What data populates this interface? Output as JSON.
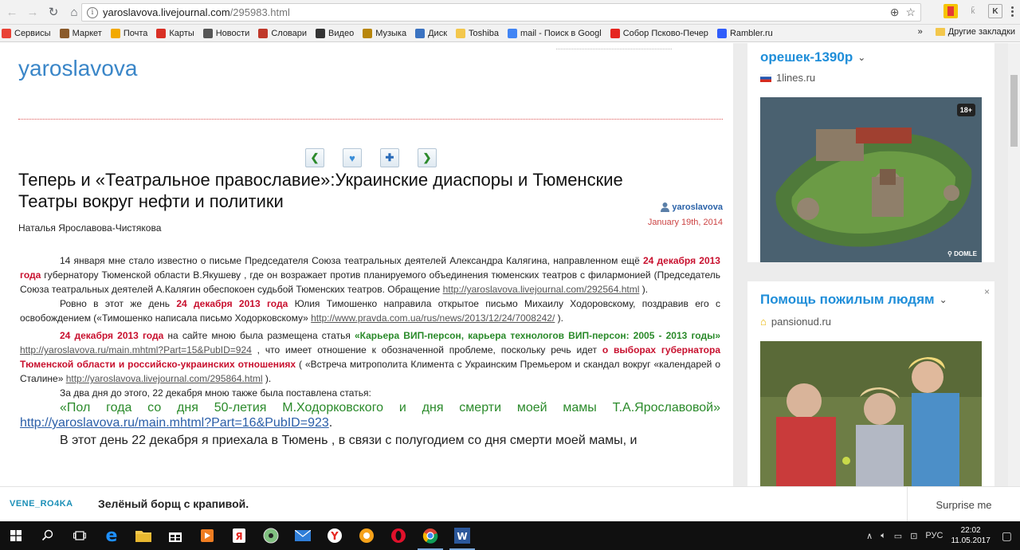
{
  "browser": {
    "url_domain": "yaroslavova.livejournal.com",
    "url_path": "/295983.html",
    "bookmarks": [
      {
        "label": "Сервисы",
        "icon": "apps-icon",
        "color": "#e94235"
      },
      {
        "label": "Маркет",
        "icon": "market-icon",
        "color": "#8a5a2a"
      },
      {
        "label": "Почта",
        "icon": "mail-icon",
        "color": "#f2a900"
      },
      {
        "label": "Карты",
        "icon": "map-pin-icon",
        "color": "#d93025"
      },
      {
        "label": "Новости",
        "icon": "news-icon",
        "color": "#555555"
      },
      {
        "label": "Словари",
        "icon": "dictionary-icon",
        "color": "#c0392b"
      },
      {
        "label": "Видео",
        "icon": "video-icon",
        "color": "#333333"
      },
      {
        "label": "Музыка",
        "icon": "music-icon",
        "color": "#b8860b"
      },
      {
        "label": "Диск",
        "icon": "disk-icon",
        "color": "#3b73c1"
      },
      {
        "label": "Toshiba",
        "icon": "folder-icon",
        "color": "#f3c74c"
      },
      {
        "label": "mail - Поиск в Googl",
        "icon": "google-icon",
        "color": "#4285f4"
      },
      {
        "label": "Собор Псково-Печер",
        "icon": "yandex-icon",
        "color": "#e52620"
      },
      {
        "label": "Rambler.ru",
        "icon": "rambler-icon",
        "color": "#315efb"
      }
    ],
    "more": "»",
    "other_bookmarks": "Другие закладки"
  },
  "site": {
    "title": "yaroslavova"
  },
  "post": {
    "title": "Теперь и «Театральное православие»:Украинские диаспоры и Тюменские Театры вокруг нефти и политики",
    "author": "yaroslavova",
    "date": "January 19th, 2014",
    "byline": "Наталья  Ярославова-Чистякова",
    "p1": {
      "a": "14     января мне стало известно   о письме   Председателя      Союза театральных  деятелей   Александра   Калягина,  направленном   ещё ",
      "red1": "24 декабря   2013 года",
      "b": " губернатору  Тюменской  области В.Якушеву , где он возражает  против     планируемого объединения    тюменских театров с    филармонией   (Председатель Союза театральных деятелей А.Калягин обеспокоен судьбой Тюменских театров. Обращение ",
      "link": "http://yaroslavova.livejournal.com/292564.html",
      "c": " )."
    },
    "p2": {
      "a": "Ровно в   этот  же  день  ",
      "red": "24 декабря 2013 года",
      "b": "   Юлия Тимошенко  направила  открытое  письмо   Михаилу Ходоровскому,  поздравив    его с освобождением («Тимошенко написала письмо Ходорковскому» ",
      "link": "http://www.pravda.com.ua/rus/news/2013/12/24/7008242/",
      "c": " )."
    },
    "p3": {
      "red": "24 декабря    2013 года",
      "a": "    на    сайте  мною  была размещена  статья ",
      "green": "«Карьера ВИП-персон, карьера технологов ВИП-персон: 2005 - 2013 годы»",
      "b": " ",
      "link": "http://yaroslavova.ru/main.mhtml?Part=15&PubID=924",
      "c": " , что     имеет  отношение к  обозначенной  проблеме,  поскольку речь идет ",
      "red2": "о выборах губернатора  Тюменской  области и   российско-украинских отношениях",
      "d": "  ( «Встреча митрополита Климента с Украинским Премьером и скандал вокруг «календарей о Сталине» ",
      "link2": "http://yaroslavova.livejournal.com/295864.html",
      "e": " )."
    },
    "p4": "За   два   дня  до этого, 22  декабря   мною  также  была  поставлена  статья:",
    "p5": {
      "green": "«Пол  года  со  дня  50-летия  М.Ходорковского  и  дня  смерти  моей  мамы  Т.А.Ярославовой»",
      "link": "http://yaroslavova.ru/main.mhtml?Part=16&PubID=923",
      "end": "."
    },
    "p6": "В  этот  день 22 декабря   я приехала в Тюмень  ,  в  связи с полугодием со  дня  смерти моей мамы,    и"
  },
  "ads": [
    {
      "title": "орешек-1390р",
      "source": "1lines.ru",
      "badge": "18+",
      "watermark": "DOMLE"
    },
    {
      "title": "Помощь пожилым людям",
      "source": "pansionud.ru",
      "close": "×"
    }
  ],
  "bottom_bar": {
    "user": "VENE_RO4KA",
    "title": "Зелёный борщ с крапивой.",
    "surprise": "Surprise me"
  },
  "taskbar": {
    "lang": "РУС",
    "time": "22:02",
    "date": "11.05.2017"
  }
}
